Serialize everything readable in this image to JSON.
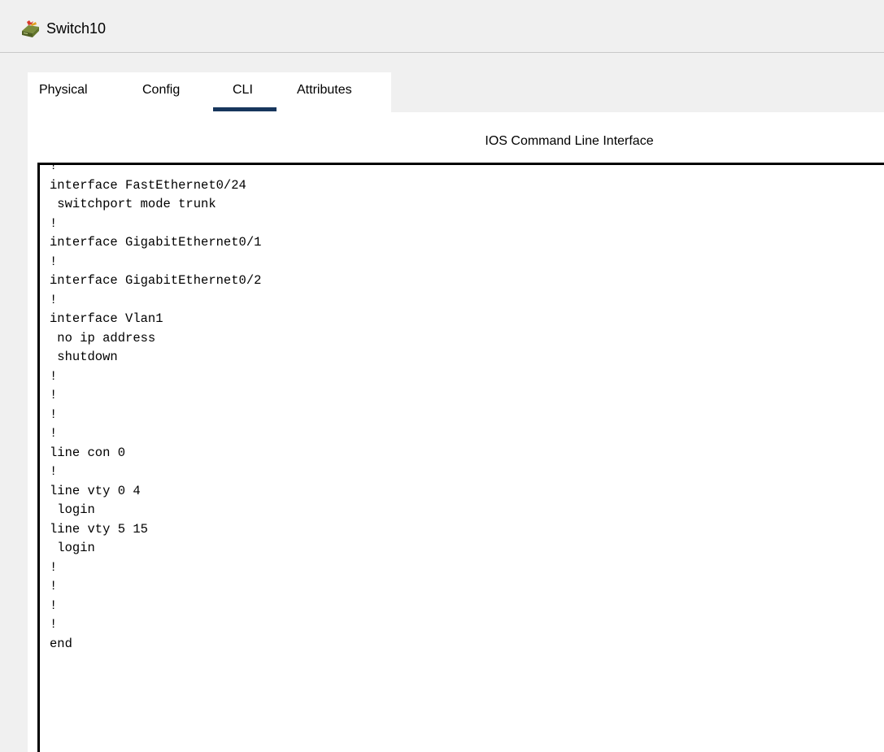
{
  "window": {
    "title": "Switch10",
    "icon": "switch-device-icon"
  },
  "tabs": [
    {
      "label": "Physical",
      "active": false
    },
    {
      "label": "Config",
      "active": false
    },
    {
      "label": "CLI",
      "active": true
    },
    {
      "label": "Attributes",
      "active": false
    }
  ],
  "cli": {
    "heading": "IOS Command Line Interface",
    "output": "!\ninterface FastEthernet0/24\n switchport mode trunk\n!\ninterface GigabitEthernet0/1\n!\ninterface GigabitEthernet0/2\n!\ninterface Vlan1\n no ip address\n shutdown\n!\n!\n!\n!\nline con 0\n!\nline vty 0 4\n login\nline vty 5 15\n login\n!\n!\n!\n!\nend"
  },
  "colors": {
    "active_tab_underline": "#17365d",
    "window_background": "#f0f0f0",
    "panel_background": "#ffffff"
  }
}
